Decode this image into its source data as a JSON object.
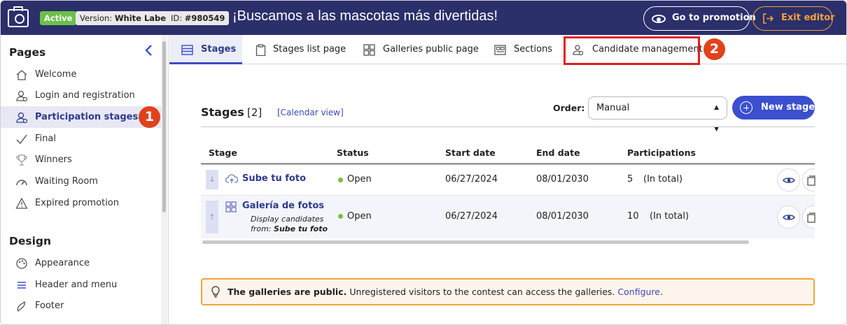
{
  "topbar": {
    "status_badge": "Active",
    "version_prefix": "Version: ",
    "version_value": "White Label",
    "id_prefix": "ID: ",
    "id_value": "#980549",
    "promotion_title": "¡Buscamos a las mascotas más divertidas!",
    "go_to_promotion": "Go to promotion",
    "exit_editor": "Exit editor"
  },
  "sidebar": {
    "pages_heading": "Pages",
    "items": [
      {
        "label": "Welcome",
        "icon": "home-icon"
      },
      {
        "label": "Login and registration",
        "icon": "user-icon"
      },
      {
        "label": "Participation stages",
        "icon": "users-icon",
        "active": true
      },
      {
        "label": "Final",
        "icon": "check-icon"
      },
      {
        "label": "Winners",
        "icon": "trophy-icon"
      },
      {
        "label": "Waiting Room",
        "icon": "gauge-icon"
      },
      {
        "label": "Expired promotion",
        "icon": "warning-icon"
      }
    ],
    "design_heading": "Design",
    "design_items": [
      {
        "label": "Appearance",
        "icon": "palette-icon"
      },
      {
        "label": "Header and menu",
        "icon": "menu-icon"
      },
      {
        "label": "Footer",
        "icon": "footprint-icon"
      }
    ]
  },
  "markers": [
    "1",
    "2"
  ],
  "tabs": [
    {
      "label": "Stages",
      "icon": "list-icon",
      "active": true
    },
    {
      "label": "Stages list page",
      "icon": "clipboard-icon"
    },
    {
      "label": "Galleries public page",
      "icon": "grid-icon"
    },
    {
      "label": "Sections",
      "icon": "layout-icon"
    },
    {
      "label": "Candidate management",
      "icon": "candidates-icon"
    }
  ],
  "main": {
    "title": "Stages",
    "count": "[2]",
    "calendar_link": "[Calendar view]",
    "order_label": "Order:",
    "order_value": "Manual",
    "new_stage": "New stage"
  },
  "table": {
    "headers": [
      "Stage",
      "Status",
      "Start date",
      "End date",
      "Participations"
    ],
    "rows": [
      {
        "name": "Sube tu foto",
        "icon": "upload-cloud-icon",
        "status": "Open",
        "start": "06/27/2024",
        "end": "08/01/2030",
        "participations": "5",
        "participations_note": "(In total)",
        "order_arrow": "↓"
      },
      {
        "name": "Galería de fotos",
        "icon": "gallery-icon",
        "sub_line1": "Display candidates",
        "sub_prefix": "from: ",
        "sub_value": "Sube tu foto",
        "status": "Open",
        "start": "06/27/2024",
        "end": "08/01/2030",
        "participations": "10",
        "participations_note": "(In total)",
        "order_arrow": "↑"
      }
    ]
  },
  "alert": {
    "bold": "The galleries are public.",
    "text": " Unregistered visitors to the contest can access the galleries. ",
    "link": "Configure",
    "end": "."
  },
  "colors": {
    "topbar": "#2b2f6a",
    "accent": "#3b4fcf",
    "active_badge": "#6cc04a",
    "exit": "#f2a23a",
    "marker": "#e0421d",
    "highlight": "#e41d1d"
  }
}
